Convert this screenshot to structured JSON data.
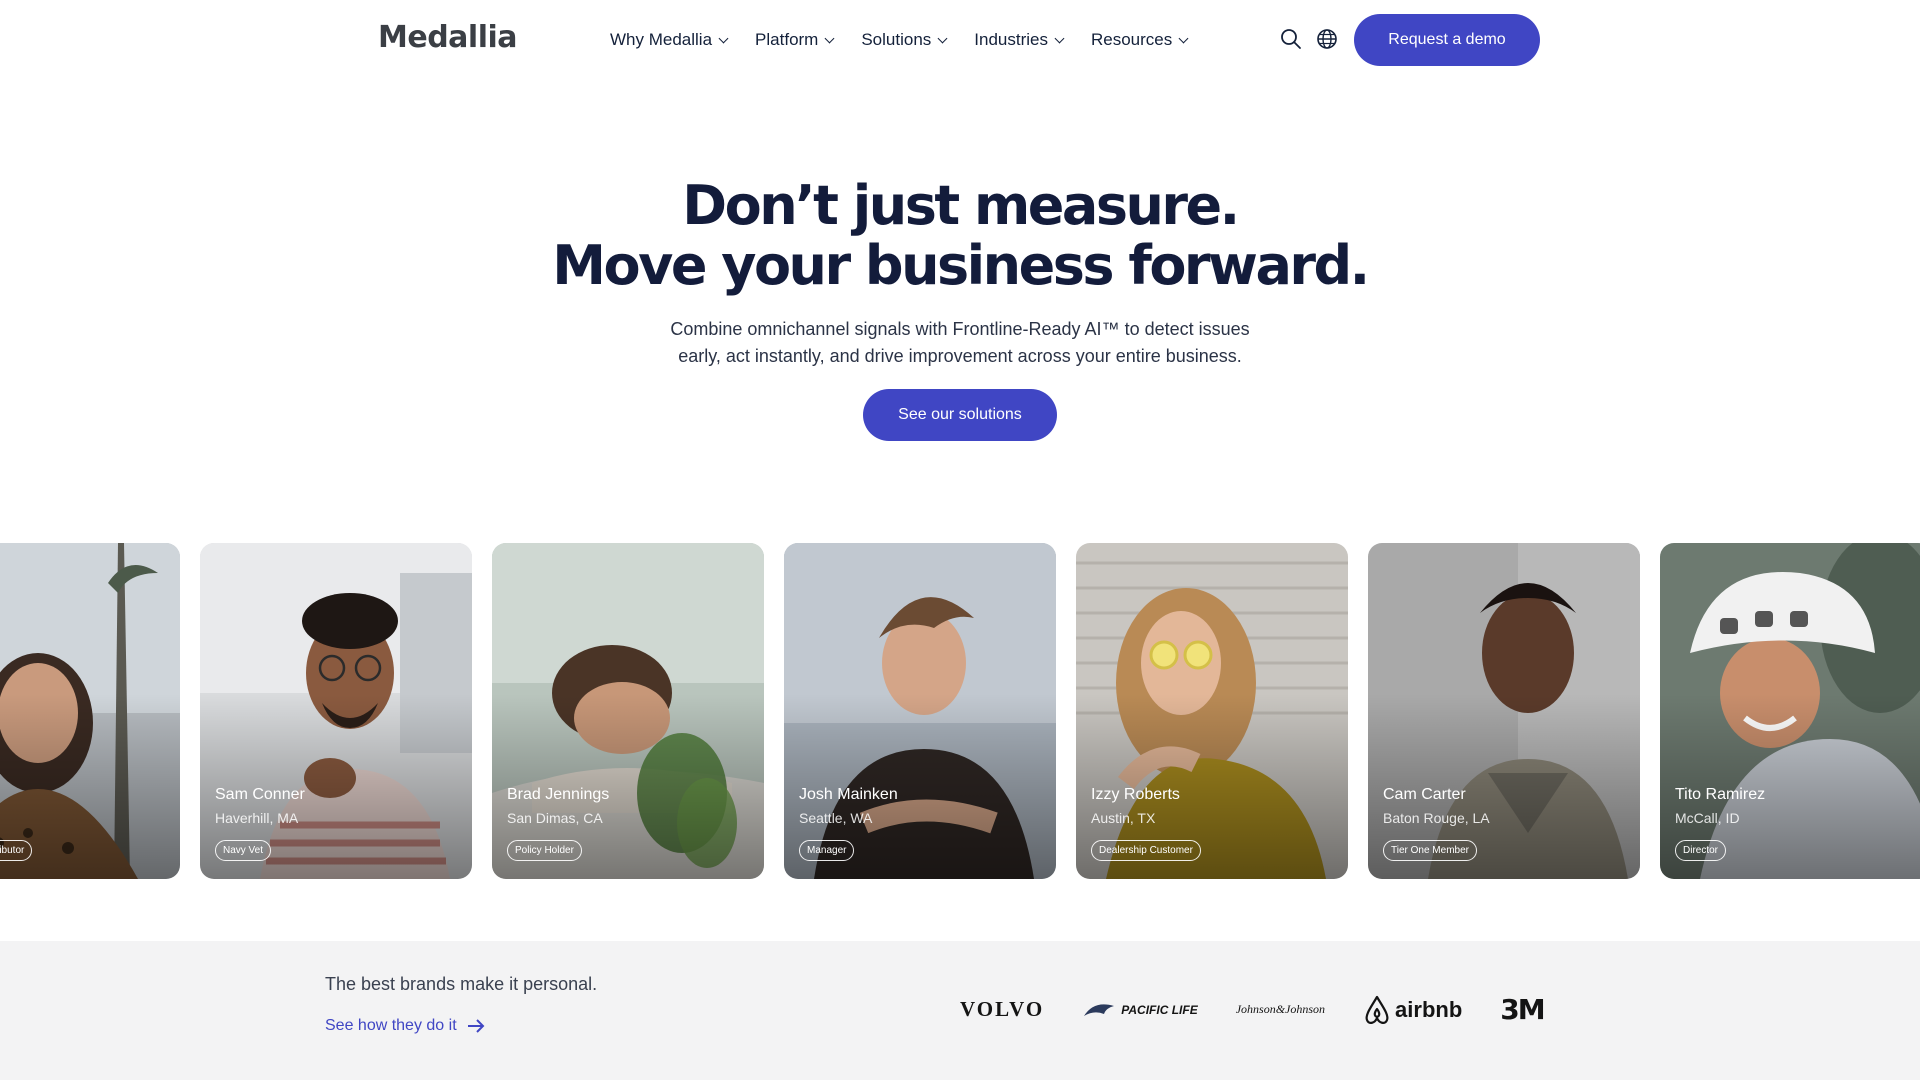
{
  "header": {
    "logo": "Medallia",
    "nav": [
      "Why Medallia",
      "Platform",
      "Solutions",
      "Industries",
      "Resources"
    ],
    "search_icon": "search-icon",
    "globe_icon": "globe-icon",
    "demo_label": "Request a demo"
  },
  "hero": {
    "title_line1": "Don’t just measure.",
    "title_line2": "Move your business forward.",
    "subtitle_line1": "Combine omnichannel signals with Frontline-Ready AI™ to detect issues",
    "subtitle_line2": "early, act instantly, and drive improvement across your entire business.",
    "cta_label": "See our solutions"
  },
  "cards": [
    {
      "name": "",
      "location": "",
      "tag": "ributor"
    },
    {
      "name": "Sam Conner",
      "location": "Haverhill, MA",
      "tag": "Navy Vet"
    },
    {
      "name": "Brad Jennings",
      "location": "San Dimas, CA",
      "tag": "Policy Holder"
    },
    {
      "name": "Josh Mainken",
      "location": "Seattle, WA",
      "tag": "Manager"
    },
    {
      "name": "Izzy Roberts",
      "location": "Austin, TX",
      "tag": "Dealership Customer"
    },
    {
      "name": "Cam Carter",
      "location": "Baton Rouge, LA",
      "tag": "Tier One Member"
    },
    {
      "name": "Tito Ramirez",
      "location": "McCall, ID",
      "tag": "Director"
    }
  ],
  "brands": {
    "text": "The best brands make it personal.",
    "link": "See how they do it",
    "logos": [
      "VOLVO",
      "PACIFIC LIFE",
      "Johnson&Johnson",
      "airbnb",
      "3M"
    ]
  },
  "colors": {
    "accent": "#4046c4",
    "heading": "#131c3b",
    "band": "#f3f3f4"
  }
}
